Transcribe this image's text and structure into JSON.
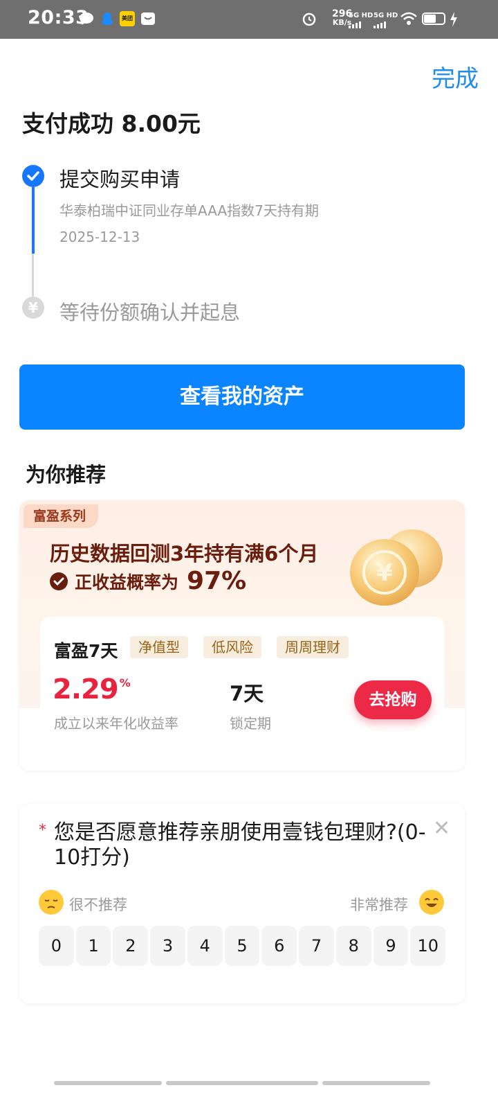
{
  "status_bar": {
    "time": "20:33",
    "net_speed_value": "296",
    "net_speed_unit": "KB/s",
    "sim1_label": "5G HD",
    "sim2_label": "5G HD",
    "app_badge": "美团",
    "icons": [
      "message-icon",
      "qq-icon",
      "meituan-icon",
      "mail-icon",
      "alarm-icon",
      "wifi-icon",
      "battery-icon",
      "charging-icon"
    ],
    "battery_level": 0.55
  },
  "header": {
    "done_label": "完成",
    "title": "支付成功 8.00元"
  },
  "timeline": {
    "step1": {
      "title": "提交购买申请",
      "product": "华泰柏瑞中证同业存单AAA指数7天持有期",
      "date": "2025-12-13",
      "status": "done"
    },
    "step2": {
      "title": "等待份额确认并起息",
      "icon_glyph": "¥",
      "status": "pending"
    }
  },
  "view_assets_label": "查看我的资产",
  "recommend": {
    "section_title": "为你推荐",
    "series_tag": "富盈系列",
    "banner_line1": "历史数据回测3年持有满6个月",
    "banner_line2_prefix": "正收益概率为",
    "banner_line2_value": "97%",
    "product": {
      "name": "富盈7天",
      "tags": [
        "净值型",
        "低风险",
        "周周理财"
      ],
      "rate_value": "2.29",
      "rate_unit": "%",
      "rate_caption": "成立以来年化收益率",
      "lock_value": "7天",
      "lock_caption": "锁定期",
      "buy_label": "去抢购"
    },
    "colors": {
      "accent": "#ec2a48",
      "brand_blue": "#0a84ff"
    }
  },
  "survey": {
    "required_mark": "*",
    "question": "您是否愿意推荐亲朋使用壹钱包理财?(0-10打分)",
    "close_glyph": "✕",
    "low_label": "很不推荐",
    "high_label": "非常推荐",
    "scores": [
      "0",
      "1",
      "2",
      "3",
      "4",
      "5",
      "6",
      "7",
      "8",
      "9",
      "10"
    ]
  }
}
